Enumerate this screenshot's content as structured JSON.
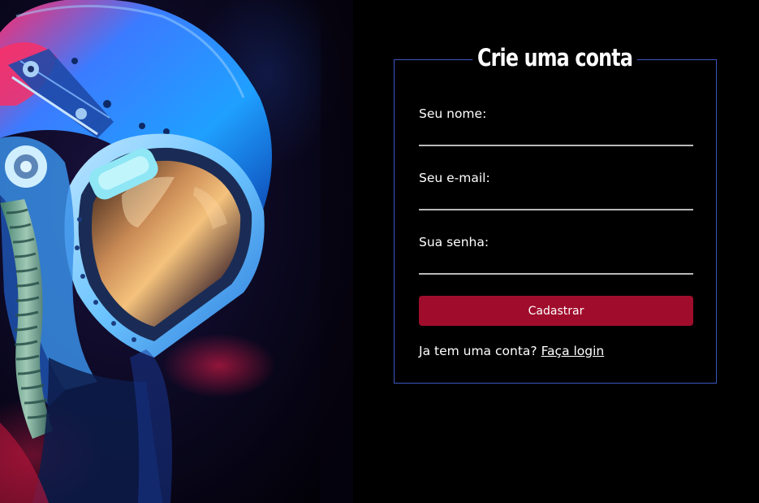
{
  "form": {
    "title": "Crie uma conta",
    "fields": [
      {
        "label": "Seu nome:",
        "value": "",
        "placeholder": ""
      },
      {
        "label": "Seu e-mail:",
        "value": "",
        "placeholder": ""
      },
      {
        "label": "Sua senha:",
        "value": "",
        "placeholder": ""
      }
    ],
    "submit_label": "Cadastrar",
    "login_prompt": "Ja tem uma conta?",
    "login_link": "Faça login"
  },
  "colors": {
    "background": "#000000",
    "border": "#3d56c2",
    "button": "#a00d2c",
    "input_underline": "#b9b9b9",
    "text": "#ffffff"
  },
  "icons": {
    "hero": "astronaut-helmet-image"
  }
}
